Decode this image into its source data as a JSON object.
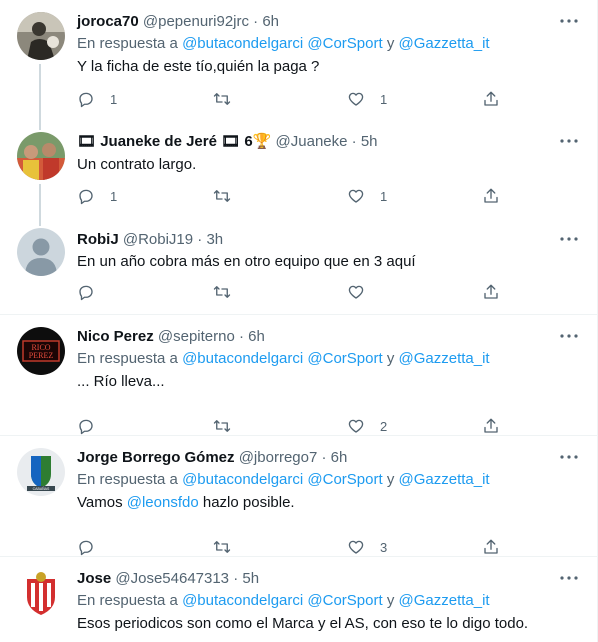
{
  "reply_prefix": "En respuesta a",
  "reply_conj": "y",
  "tweets": [
    {
      "display_name": "joroca70",
      "handle": "@pepenuri92jrc",
      "time": "6h",
      "reply_to": [
        "@butacondelgarci",
        "@CorSport",
        "@Gazzetta_it"
      ],
      "text": "Y la ficha de este tío,quién la paga ?",
      "counts": {
        "reply": "1",
        "retweet": "",
        "like": "1"
      }
    },
    {
      "display_name": "🎞 Juaneke de Jeré 🎞 6🏆",
      "handle": "@Juaneke",
      "time": "5h",
      "text": "Un contrato largo.",
      "counts": {
        "reply": "1",
        "retweet": "",
        "like": "1"
      }
    },
    {
      "display_name": "RobiJ",
      "handle": "@RobiJ19",
      "time": "3h",
      "text": "En un año cobra más en otro equipo que en 3 aquí",
      "counts": {
        "reply": "",
        "retweet": "",
        "like": ""
      }
    },
    {
      "display_name": "Nico Perez",
      "handle": "@sepiterno",
      "time": "6h",
      "reply_to": [
        "@butacondelgarci",
        "@CorSport",
        "@Gazzetta_it"
      ],
      "text": "... Río lleva...",
      "counts": {
        "reply": "",
        "retweet": "",
        "like": "2"
      }
    },
    {
      "display_name": "Jorge Borrego Gómez",
      "handle": "@jborrego7",
      "time": "6h",
      "reply_to": [
        "@butacondelgarci",
        "@CorSport",
        "@Gazzetta_it"
      ],
      "text_before": "Vamos",
      "mention": "@leonsfdo",
      "text_after": "hazlo posible.",
      "counts": {
        "reply": "",
        "retweet": "",
        "like": "3"
      }
    },
    {
      "display_name": "Jose",
      "handle": "@Jose54647313",
      "time": "5h",
      "reply_to": [
        "@butacondelgarci",
        "@CorSport",
        "@Gazzetta_it"
      ],
      "text": "Esos periodicos son como el Marca y el AS, con eso te lo digo todo.",
      "counts": {
        "reply": "",
        "retweet": "",
        "like": ""
      }
    }
  ],
  "colors": {
    "link": "#1d9bf0",
    "muted": "#536471",
    "text": "#0f1419",
    "border": "#eff3f4",
    "thread": "#cfd9de"
  },
  "icons": [
    "reply-icon",
    "retweet-icon",
    "like-icon",
    "share-icon",
    "more-icon"
  ]
}
